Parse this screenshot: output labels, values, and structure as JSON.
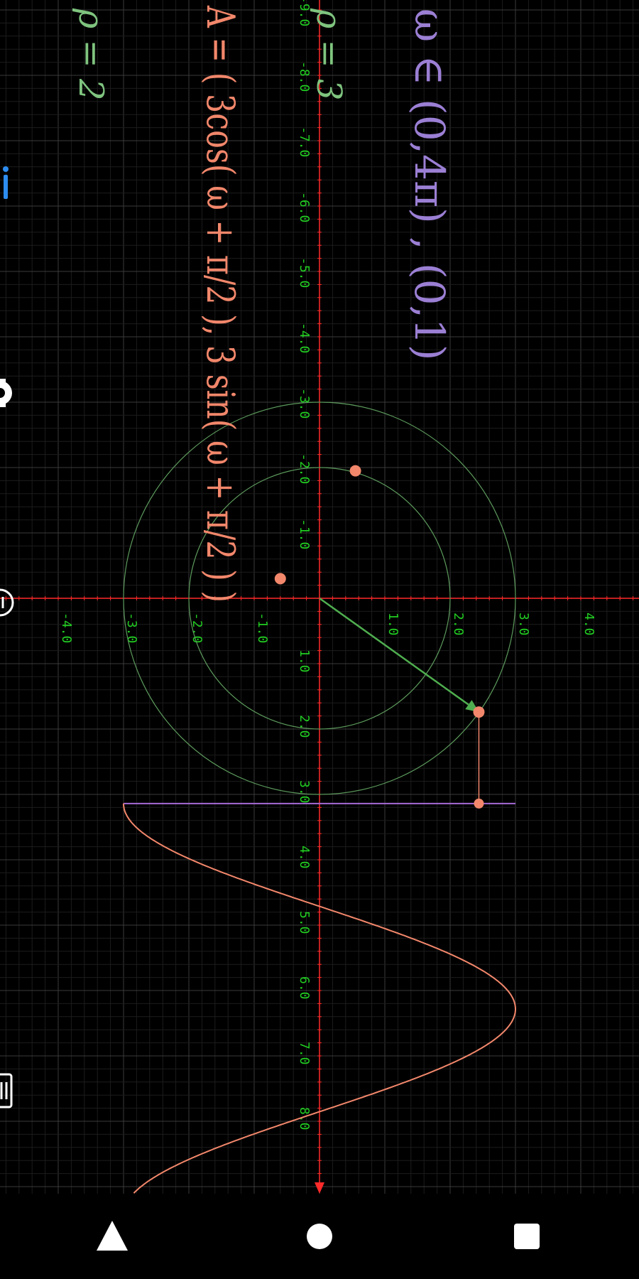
{
  "colors": {
    "background": "#000000",
    "grid_minor": "#1c1c1c",
    "grid_major": "#3a3a3a",
    "axis": "#ff2a2a",
    "tick_label": "#22cc22",
    "circle": "#5c9a5c",
    "curve": "#f2876b",
    "point": "#f2876b",
    "vector": "#4fae4f",
    "horizontal_line": "#a66ad6",
    "omega_expr": "#9b7fd4",
    "rho_label": "#7fc47f",
    "a_expr": "#f2876b",
    "info_icon": "#2d8cf0"
  },
  "expressions": {
    "omega_range": "ω ∈ (0,4π) , (0,1)",
    "rho_outer": "ρ = 3",
    "rho_inner": "ρ = 2",
    "a_vector": "A = ( 3cos( ω + π/2 ), 3 sin( ω + π/2 ) )"
  },
  "axis_ticks": {
    "along_screen_x": [
      "-4.0",
      "-3.0",
      "-2.0",
      "-1.0",
      "1.0",
      "2.0",
      "3.0",
      "4.0"
    ],
    "along_screen_y": [
      "-9.0",
      "-8.0",
      "-7.0",
      "-6.0",
      "-5.0",
      "-4.0",
      "-3.0",
      "-2.0",
      "-1.0",
      "1.0",
      "2.0",
      "3.0",
      "4.0",
      "5.0",
      "6.0",
      "7.0",
      "8.0"
    ]
  },
  "graph": {
    "circle_radii": [
      2,
      3
    ],
    "vector_tip": [
      2.44,
      1.74
    ],
    "projected_point": [
      2.44,
      3.14
    ],
    "extra_points": [
      [
        -0.6,
        -0.3
      ],
      [
        0.55,
        -1.95
      ]
    ],
    "wave": {
      "amplitude": 3,
      "phase": 1.5708,
      "y_from": 3.14,
      "y_to": 9.1
    }
  },
  "icons": {
    "info": "info-icon",
    "settings": "gear-icon",
    "zoom": "zoom-icon",
    "list": "list-icon",
    "back": "back-icon",
    "home": "home-icon",
    "recents": "recents-icon"
  }
}
